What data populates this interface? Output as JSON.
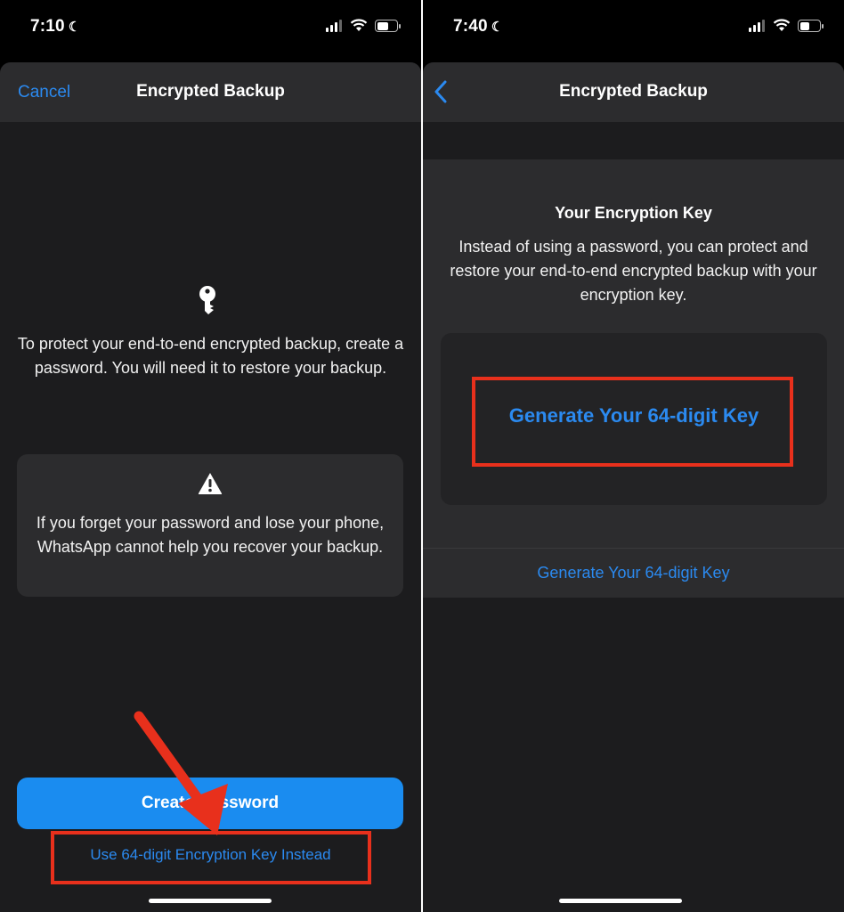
{
  "left_screen": {
    "status": {
      "time": "7:10"
    },
    "nav": {
      "cancel": "Cancel",
      "title": "Encrypted Backup"
    },
    "intro": "To protect your end-to-end encrypted backup, create a password. You will need it to restore your backup.",
    "warning": "If you forget your password and lose your phone, WhatsApp cannot help you recover your backup.",
    "primary_button": "Create Password",
    "alt_link": "Use 64-digit Encryption Key Instead"
  },
  "right_screen": {
    "status": {
      "time": "7:40"
    },
    "nav": {
      "title": "Encrypted Backup"
    },
    "section_title": "Your Encryption Key",
    "description": "Instead of using a password, you can protect and restore your end-to-end encrypted backup with your encryption key.",
    "generate_button": "Generate Your 64-digit Key",
    "generate_link": "Generate Your 64-digit Key"
  },
  "colors": {
    "accent": "#2b8af0",
    "button_fill": "#1a8cf0",
    "highlight": "#e8301c",
    "sheet_background": "#1c1c1e",
    "card_background": "#2c2c2e"
  },
  "icons": [
    "moon-icon",
    "signal-icon",
    "wifi-icon",
    "battery-icon",
    "key-icon",
    "warning-icon",
    "back-chevron-icon",
    "annotation-arrow"
  ]
}
